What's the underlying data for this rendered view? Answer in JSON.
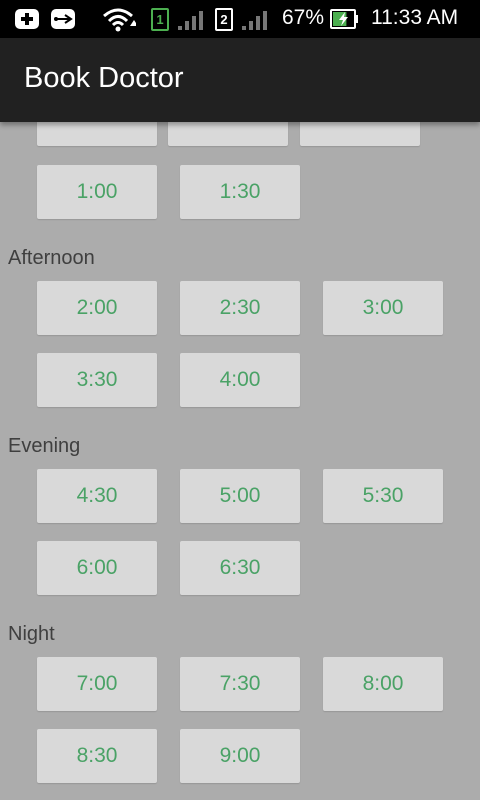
{
  "status_bar": {
    "battery_percent": "67%",
    "time": "11:33 AM",
    "sim1_label": "1",
    "sim2_label": "2",
    "battery_fill": 0.67,
    "accent": "#4caf50"
  },
  "app_bar": {
    "title": "Book Doctor"
  },
  "sections": {
    "partial_top": {
      "slots": [
        "",
        "",
        ""
      ]
    },
    "midday": {
      "slots": [
        "1:00",
        "1:30"
      ]
    },
    "afternoon": {
      "label": "Afternoon",
      "slots": [
        "2:00",
        "2:30",
        "3:00",
        "3:30",
        "4:00"
      ]
    },
    "evening": {
      "label": "Evening",
      "slots": [
        "4:30",
        "5:00",
        "5:30",
        "6:00",
        "6:30"
      ]
    },
    "night": {
      "label": "Night",
      "slots": [
        "7:00",
        "7:30",
        "8:00",
        "8:30",
        "9:00"
      ]
    }
  },
  "colors": {
    "slot_text": "#4aa266",
    "background": "#acacac",
    "app_bar": "#212121"
  }
}
